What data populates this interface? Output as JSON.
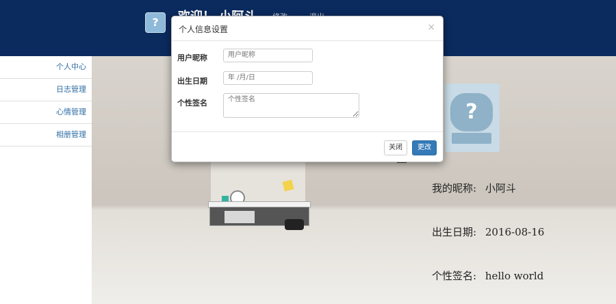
{
  "header": {
    "logo_icon": "question-bear-icon",
    "welcome": "欢迎！ 小阿斗",
    "links": [
      "修改",
      "退出"
    ]
  },
  "sidebar": {
    "items": [
      {
        "label": "个人中心"
      },
      {
        "label": "日志管理"
      },
      {
        "label": "心情管理"
      },
      {
        "label": "相册管理"
      }
    ]
  },
  "profile": {
    "nickname_label": "我的昵称:",
    "nickname": "小阿斗",
    "birthday_label": "出生日期:",
    "birthday": "2016-08-16",
    "signature_label": "个性签名:",
    "signature": "hello world"
  },
  "modal": {
    "title": "个人信息设置",
    "close_glyph": "×",
    "fields": {
      "username_label": "用户昵称",
      "username_placeholder": "用户昵称",
      "birthday_label": "出生日期",
      "birthday_placeholder": "年 /月/日",
      "signature_label": "个性签名",
      "signature_placeholder": "个性签名"
    },
    "buttons": {
      "close": "关闭",
      "submit": "更改"
    }
  },
  "colors": {
    "header_bg": "#0b2a5e",
    "link": "#2e6da4",
    "primary_button": "#337ab7"
  }
}
